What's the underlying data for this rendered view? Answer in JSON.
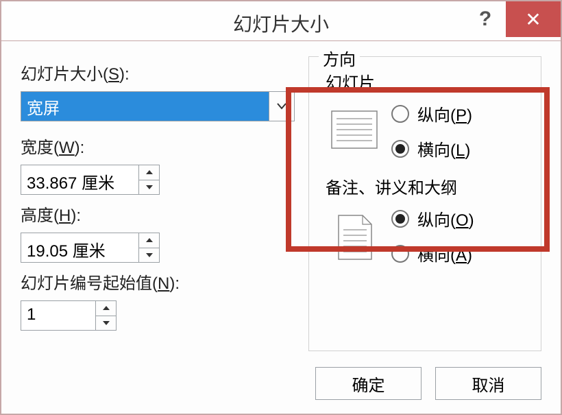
{
  "title": "幻灯片大小",
  "help_glyph": "?",
  "close_glyph": "✕",
  "left": {
    "size_label_pre": "幻灯片大小(",
    "size_key": "S",
    "size_label_post": "):",
    "size_value": "宽屏",
    "width_label_pre": "宽度(",
    "width_key": "W",
    "width_label_post": "):",
    "width_value": "33.867 厘米",
    "height_label_pre": "高度(",
    "height_key": "H",
    "height_label_post": "):",
    "height_value": "19.05 厘米",
    "start_label_pre": "幻灯片编号起始值(",
    "start_key": "N",
    "start_label_post": "):",
    "start_value": "1"
  },
  "orient": {
    "group_title": "方向",
    "slides_title": "幻灯片",
    "portrait_pre": "纵向(",
    "portrait_key_slide": "P",
    "landscape_pre": "横向(",
    "landscape_key_slide": "L",
    "post": ")",
    "notes_title": "备注、讲义和大纲",
    "portrait_key_notes": "O",
    "landscape_key_notes": "A",
    "slides_selected": "landscape",
    "notes_selected": "portrait"
  },
  "buttons": {
    "ok": "确定",
    "cancel": "取消"
  }
}
